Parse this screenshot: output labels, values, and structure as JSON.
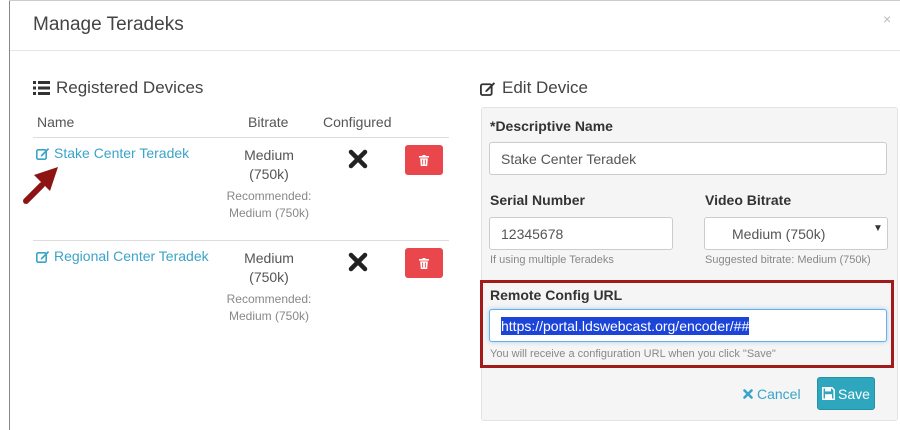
{
  "dialog": {
    "title": "Manage Teradeks",
    "close_glyph": "×"
  },
  "registered": {
    "title": "Registered Devices",
    "columns": {
      "name": "Name",
      "bitrate": "Bitrate",
      "configured": "Configured"
    },
    "devices": [
      {
        "name": "Stake Center Teradek",
        "bitrate_line1": "Medium",
        "bitrate_line2": "(750k)",
        "rec_line1": "Recommended:",
        "rec_line2": "Medium (750k)",
        "configured_icon": "x-icon"
      },
      {
        "name": "Regional Center Teradek",
        "bitrate_line1": "Medium",
        "bitrate_line2": "(750k)",
        "rec_line1": "Recommended:",
        "rec_line2": "Medium (750k)",
        "configured_icon": "x-icon"
      }
    ]
  },
  "edit": {
    "title": "Edit Device",
    "descriptive_name_label": "*Descriptive Name",
    "descriptive_name_value": "Stake Center Teradek",
    "serial_label": "Serial Number",
    "serial_value": "12345678",
    "serial_help": "If using multiple Teradeks",
    "bitrate_label": "Video Bitrate",
    "bitrate_value": "Medium (750k)",
    "bitrate_help": "Suggested bitrate: Medium (750k)",
    "remote_label": "Remote Config URL",
    "remote_value": "https://portal.ldswebcast.org/encoder/##",
    "remote_help": "You will receive a configuration URL when you click \"Save\"",
    "cancel_label": "Cancel",
    "save_label": "Save"
  },
  "colors": {
    "link": "#3aa4c9",
    "delete": "#e9474b",
    "save": "#2ea7be",
    "highlight_box": "#a21a1a",
    "selection": "#1c44d9"
  }
}
